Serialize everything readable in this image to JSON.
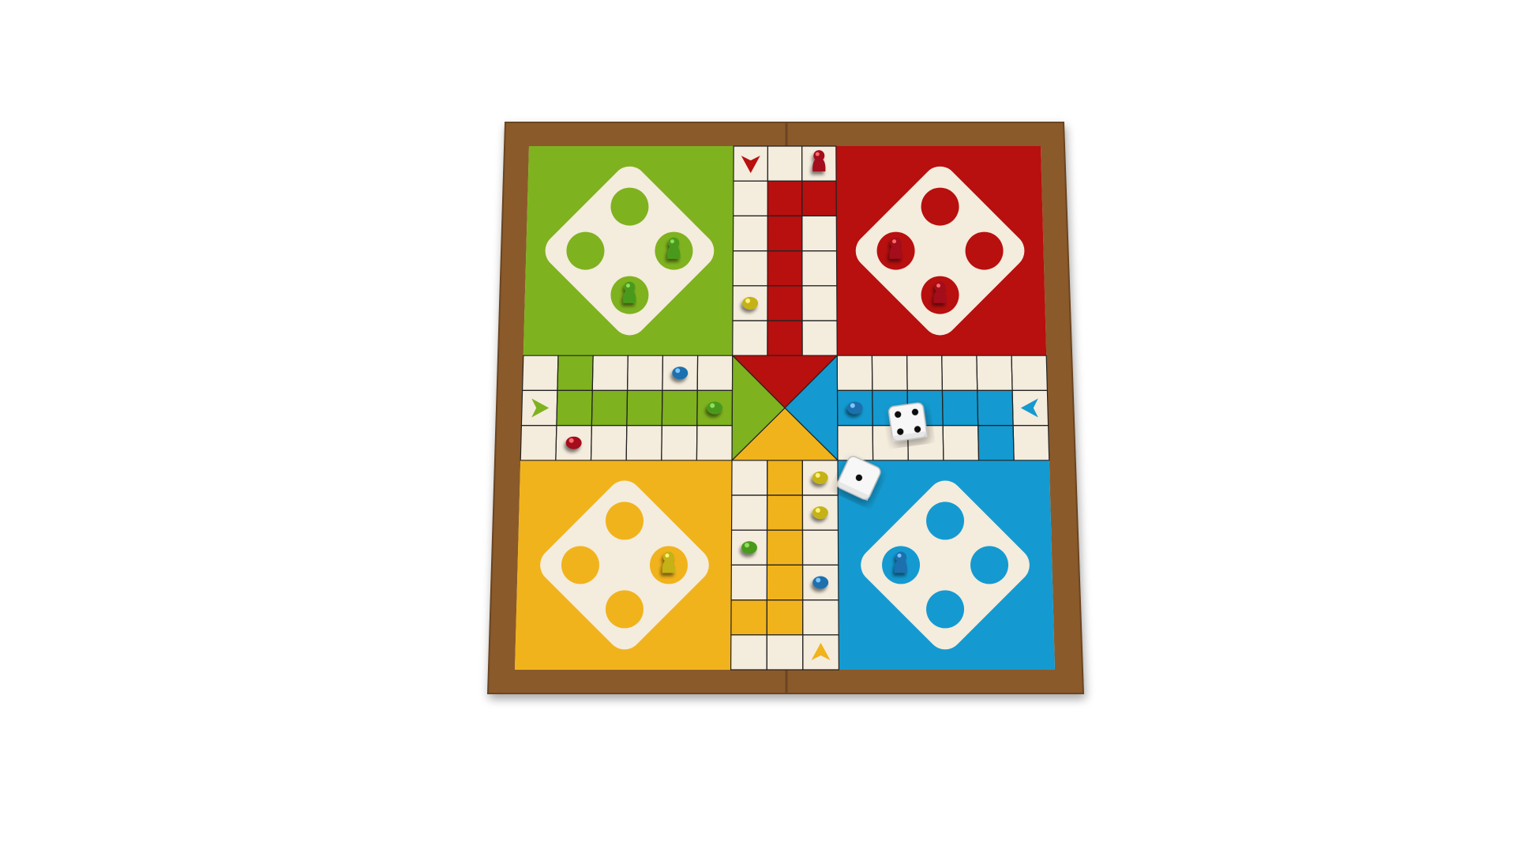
{
  "board": {
    "colors": {
      "frame": "#8b5a2b",
      "frame_edge": "#6b4420",
      "paper": "#f4ecdd",
      "green": "#7fb21f",
      "red": "#b80f0f",
      "yellow": "#f1b31c",
      "blue": "#149ad0",
      "grid": "#222222"
    },
    "home_quadrants": [
      {
        "color": "green",
        "position": "top-left"
      },
      {
        "color": "red",
        "position": "top-right"
      },
      {
        "color": "yellow",
        "position": "bottom-left"
      },
      {
        "color": "blue",
        "position": "bottom-right"
      }
    ],
    "start_arrows": [
      {
        "color": "red",
        "direction": "down"
      },
      {
        "color": "green",
        "direction": "right"
      },
      {
        "color": "blue",
        "direction": "left"
      },
      {
        "color": "yellow",
        "direction": "up"
      }
    ]
  },
  "pieces": {
    "in_home": {
      "green": 2,
      "red": 2,
      "yellow": 1,
      "blue": 1
    },
    "on_track": {
      "green": 2,
      "red": 2,
      "yellow": 3,
      "blue": 3
    }
  },
  "dice": [
    {
      "id": "die-1",
      "face": 4
    },
    {
      "id": "die-2",
      "face": 1
    }
  ]
}
